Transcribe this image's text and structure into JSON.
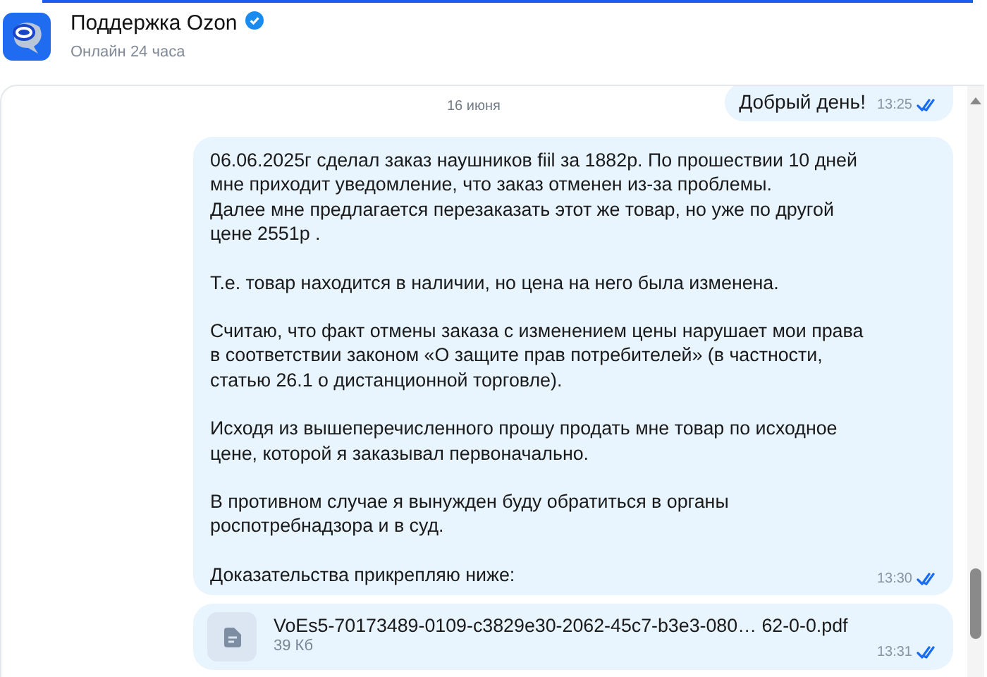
{
  "header": {
    "title": "Поддержка Ozon",
    "verified": true,
    "status": "Онлайн 24 часа"
  },
  "chat": {
    "date": "16 июня",
    "messages": [
      {
        "kind": "text",
        "paragraphs": [
          "Добрый день!"
        ],
        "time": "13:25",
        "read": true
      },
      {
        "kind": "text",
        "paragraphs": [
          "06.06.2025г сделал заказ наушников fiil за 1882р. По прошествии 10 дней\nмне приходит уведомление, что заказ отменен из-за проблемы.\nДалее мне предлагается перезаказать этот же товар, но уже по другой\nцене 2551р .",
          "Т.е. товар находится в наличии, но цена на него была изменена.",
          "Считаю, что факт отмены заказа с изменением цены нарушает мои права\nв соответствии законом «О защите прав потребителей» (в частности,\nстатью 26.1 о дистанционной торговле).",
          "Исходя из вышеперечисленного прошу продать мне товар по исходное\nцене, которой я заказывал первоначально.",
          "В противном случае я вынужден буду обратиться в органы\nроспотребнадзора и в суд.",
          "Доказательства прикрепляю ниже:"
        ],
        "time": "13:30",
        "read": true
      },
      {
        "kind": "file",
        "filename": "VoEs5-70173489-0109-c3829e30-2062-45c7-b3e3-080… 62-0-0.pdf",
        "size": "39 Кб",
        "time": "13:31",
        "read": true
      }
    ]
  }
}
